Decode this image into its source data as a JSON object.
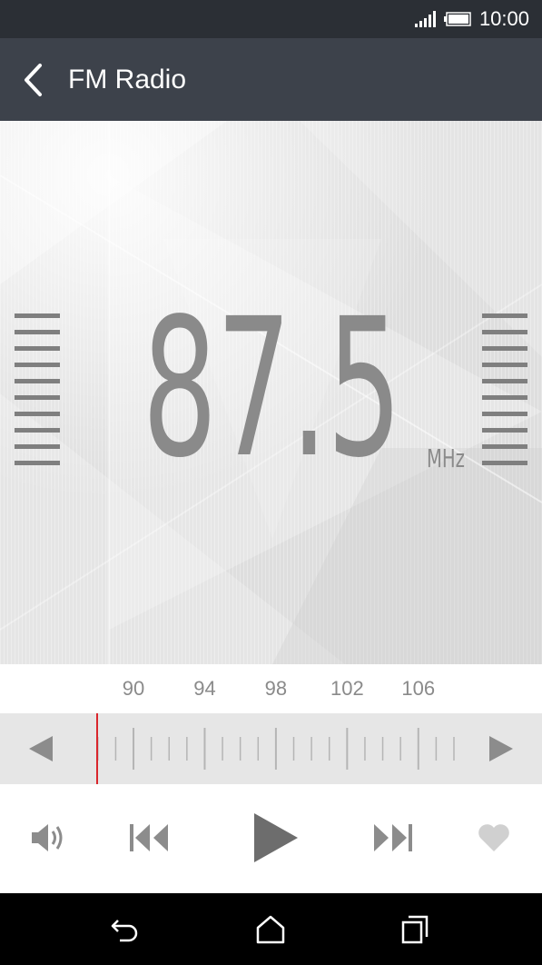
{
  "status_bar": {
    "time": "10:00",
    "icons": [
      "signal-icon",
      "battery-icon"
    ]
  },
  "app_bar": {
    "title": "FM Radio",
    "back_icon": "chevron-left-icon"
  },
  "tuner_display": {
    "frequency": "87.5",
    "unit": "MHz"
  },
  "scale": {
    "labels": [
      "90",
      "94",
      "98",
      "102",
      "106"
    ],
    "min": 87.5,
    "max": 108,
    "current": 87.5
  },
  "controls": {
    "icons": [
      "speaker-icon",
      "previous-station-icon",
      "play-icon",
      "next-station-icon",
      "favorite-heart-icon"
    ]
  },
  "nav_bar": {
    "icons": [
      "back-icon",
      "home-icon",
      "recent-apps-icon"
    ]
  },
  "colors": {
    "status_bar": "#2b2f35",
    "app_bar": "#3d424b",
    "display_text": "#8a8a8a",
    "needle": "#d9262c",
    "control_icon": "#8c8c8c"
  }
}
